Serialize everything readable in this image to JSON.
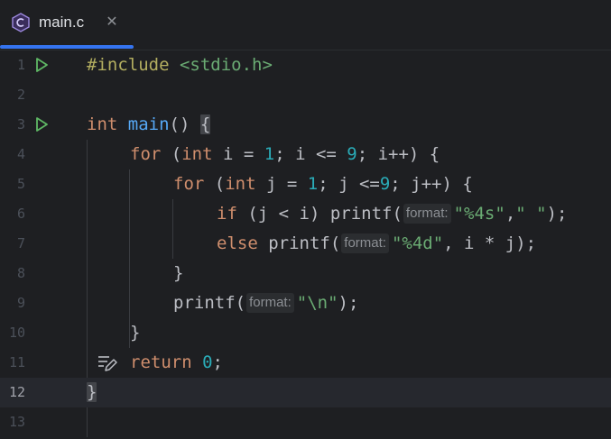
{
  "tab": {
    "icon": "c-file-icon",
    "title": "main.c",
    "close_icon": "close-icon"
  },
  "editor": {
    "current_line": 12,
    "lines": [
      {
        "n": "1",
        "run": true
      },
      {
        "n": "2"
      },
      {
        "n": "3",
        "run": true
      },
      {
        "n": "4"
      },
      {
        "n": "5"
      },
      {
        "n": "6"
      },
      {
        "n": "7"
      },
      {
        "n": "8"
      },
      {
        "n": "9"
      },
      {
        "n": "10"
      },
      {
        "n": "11"
      },
      {
        "n": "12"
      },
      {
        "n": "13"
      }
    ],
    "code": {
      "l1_directive": "#include",
      "l1_header": " <stdio.h>",
      "l3_type": "int",
      "l3_name": "main",
      "l3_paren": "() ",
      "l3_brace": "{",
      "l4_kw": "for",
      "l4_a": " (",
      "l4_type": "int",
      "l4_b": " i = ",
      "l4_n1": "1",
      "l4_c": "; i <= ",
      "l4_n2": "9",
      "l4_d": "; i++) {",
      "l5_kw": "for",
      "l5_a": " (",
      "l5_type": "int",
      "l5_b": " j = ",
      "l5_n1": "1",
      "l5_c": "; j <=",
      "l5_n2": "9",
      "l5_d": "; j++) {",
      "l6_kw": "if",
      "l6_a": " (j < i) ",
      "l6_fn": "printf(",
      "l6_hint": "format:",
      "l6_str": "\"%4s\"",
      "l6_b": ",",
      "l6_str2": "\" \"",
      "l6_c": ");",
      "l7_kw": "else",
      "l7_fn": " printf(",
      "l7_hint": "format:",
      "l7_str": "\"%4d\"",
      "l7_b": ", i * j);",
      "l8": "}",
      "l9_fn": "printf(",
      "l9_hint": "format:",
      "l9_str": "\"\\n\"",
      "l9_b": ");",
      "l10": "}",
      "l11_kw": "return",
      "l11_sp": " ",
      "l11_num": "0",
      "l11_b": ";",
      "l12": "}"
    },
    "icons": {
      "run": "run-gutter-icon",
      "lens": "edit-lens-icon"
    },
    "colors": {
      "keyword": "#cf8e6d",
      "preprocessor": "#b3ae60",
      "function": "#56a8f5",
      "number": "#2aacb8",
      "string": "#6aab73",
      "text": "#bcbec4",
      "accent": "#3574f0"
    }
  }
}
